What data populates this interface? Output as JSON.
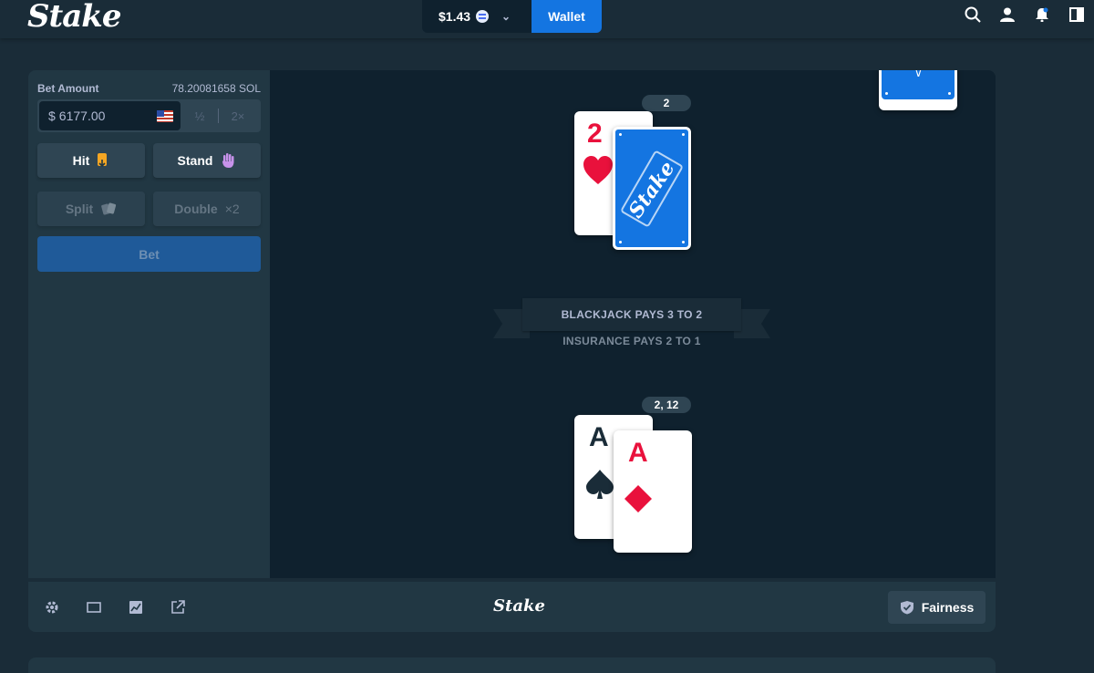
{
  "topbar": {
    "logo": "Stake",
    "balance": "$1.43",
    "wallet_label": "Wallet"
  },
  "sidebar": {
    "bet_amount_label": "Bet Amount",
    "bet_amount_crypto": "78.20081658 SOL",
    "currency_symbol": "$",
    "bet_value": "6177.00",
    "half_label": "½",
    "double_label": "2×",
    "hit_label": "Hit",
    "stand_label": "Stand",
    "split_label": "Split",
    "double_down_label": "Double",
    "double_down_suffix": "×2",
    "bet_button_label": "Bet"
  },
  "table": {
    "dealer_total": "2",
    "player_total": "2, 12",
    "blackjack_text": "BLACKJACK PAYS 3 TO 2",
    "insurance_text": "INSURANCE PAYS 2 TO 1",
    "back_logo": "Stake",
    "dealer_cards": [
      {
        "rank": "2",
        "suit": "hearts",
        "color": "#e9113c"
      },
      {
        "rank": "",
        "suit": "back",
        "color": "#1475e1"
      }
    ],
    "player_cards": [
      {
        "rank": "A",
        "suit": "spades",
        "color": "#1a2c38"
      },
      {
        "rank": "A",
        "suit": "diamonds",
        "color": "#e9113c"
      }
    ]
  },
  "footer": {
    "logo": "Stake",
    "fairness_label": "Fairness",
    "icons": [
      "gear-icon",
      "theatre-mode-icon",
      "stats-icon",
      "popout-icon"
    ]
  },
  "colors": {
    "bg": "#1a2c38",
    "panel": "#213743",
    "stage": "#0f212e",
    "accent": "#1475e1",
    "red": "#e9113c"
  }
}
